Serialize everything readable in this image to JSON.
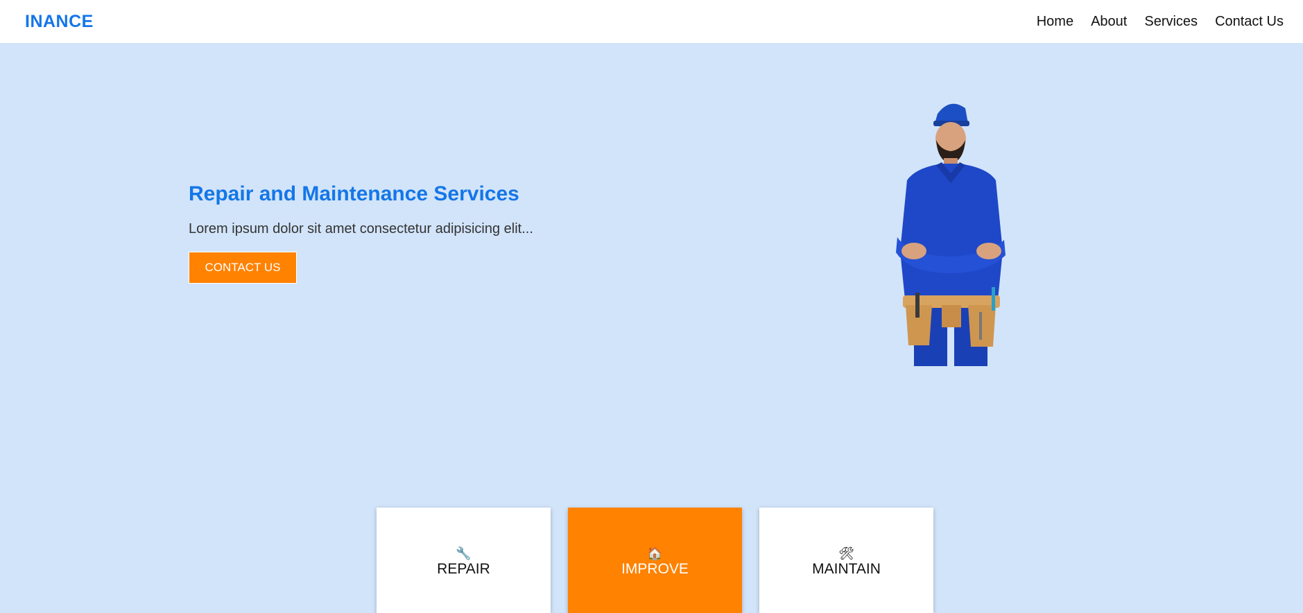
{
  "header": {
    "brand": "INANCE",
    "nav": [
      {
        "label": "Home"
      },
      {
        "label": "About"
      },
      {
        "label": "Services"
      },
      {
        "label": "Contact Us"
      }
    ]
  },
  "hero": {
    "title": "Repair and Maintenance Services",
    "description": "Lorem ipsum dolor sit amet consectetur adipisicing elit...",
    "cta_label": "CONTACT US",
    "image_icon": "handyman-worker-image"
  },
  "services": [
    {
      "icon": "🔧",
      "icon_name": "wrench-icon",
      "label": "REPAIR"
    },
    {
      "icon": "🏠",
      "icon_name": "house-icon",
      "label": "IMPROVE"
    },
    {
      "icon": "🛠",
      "icon_name": "hammer-wrench-icon",
      "label": "MAINTAIN"
    }
  ],
  "colors": {
    "accent_blue": "#1476e8",
    "accent_orange": "#ff8200",
    "background": "#d2e4fa"
  }
}
